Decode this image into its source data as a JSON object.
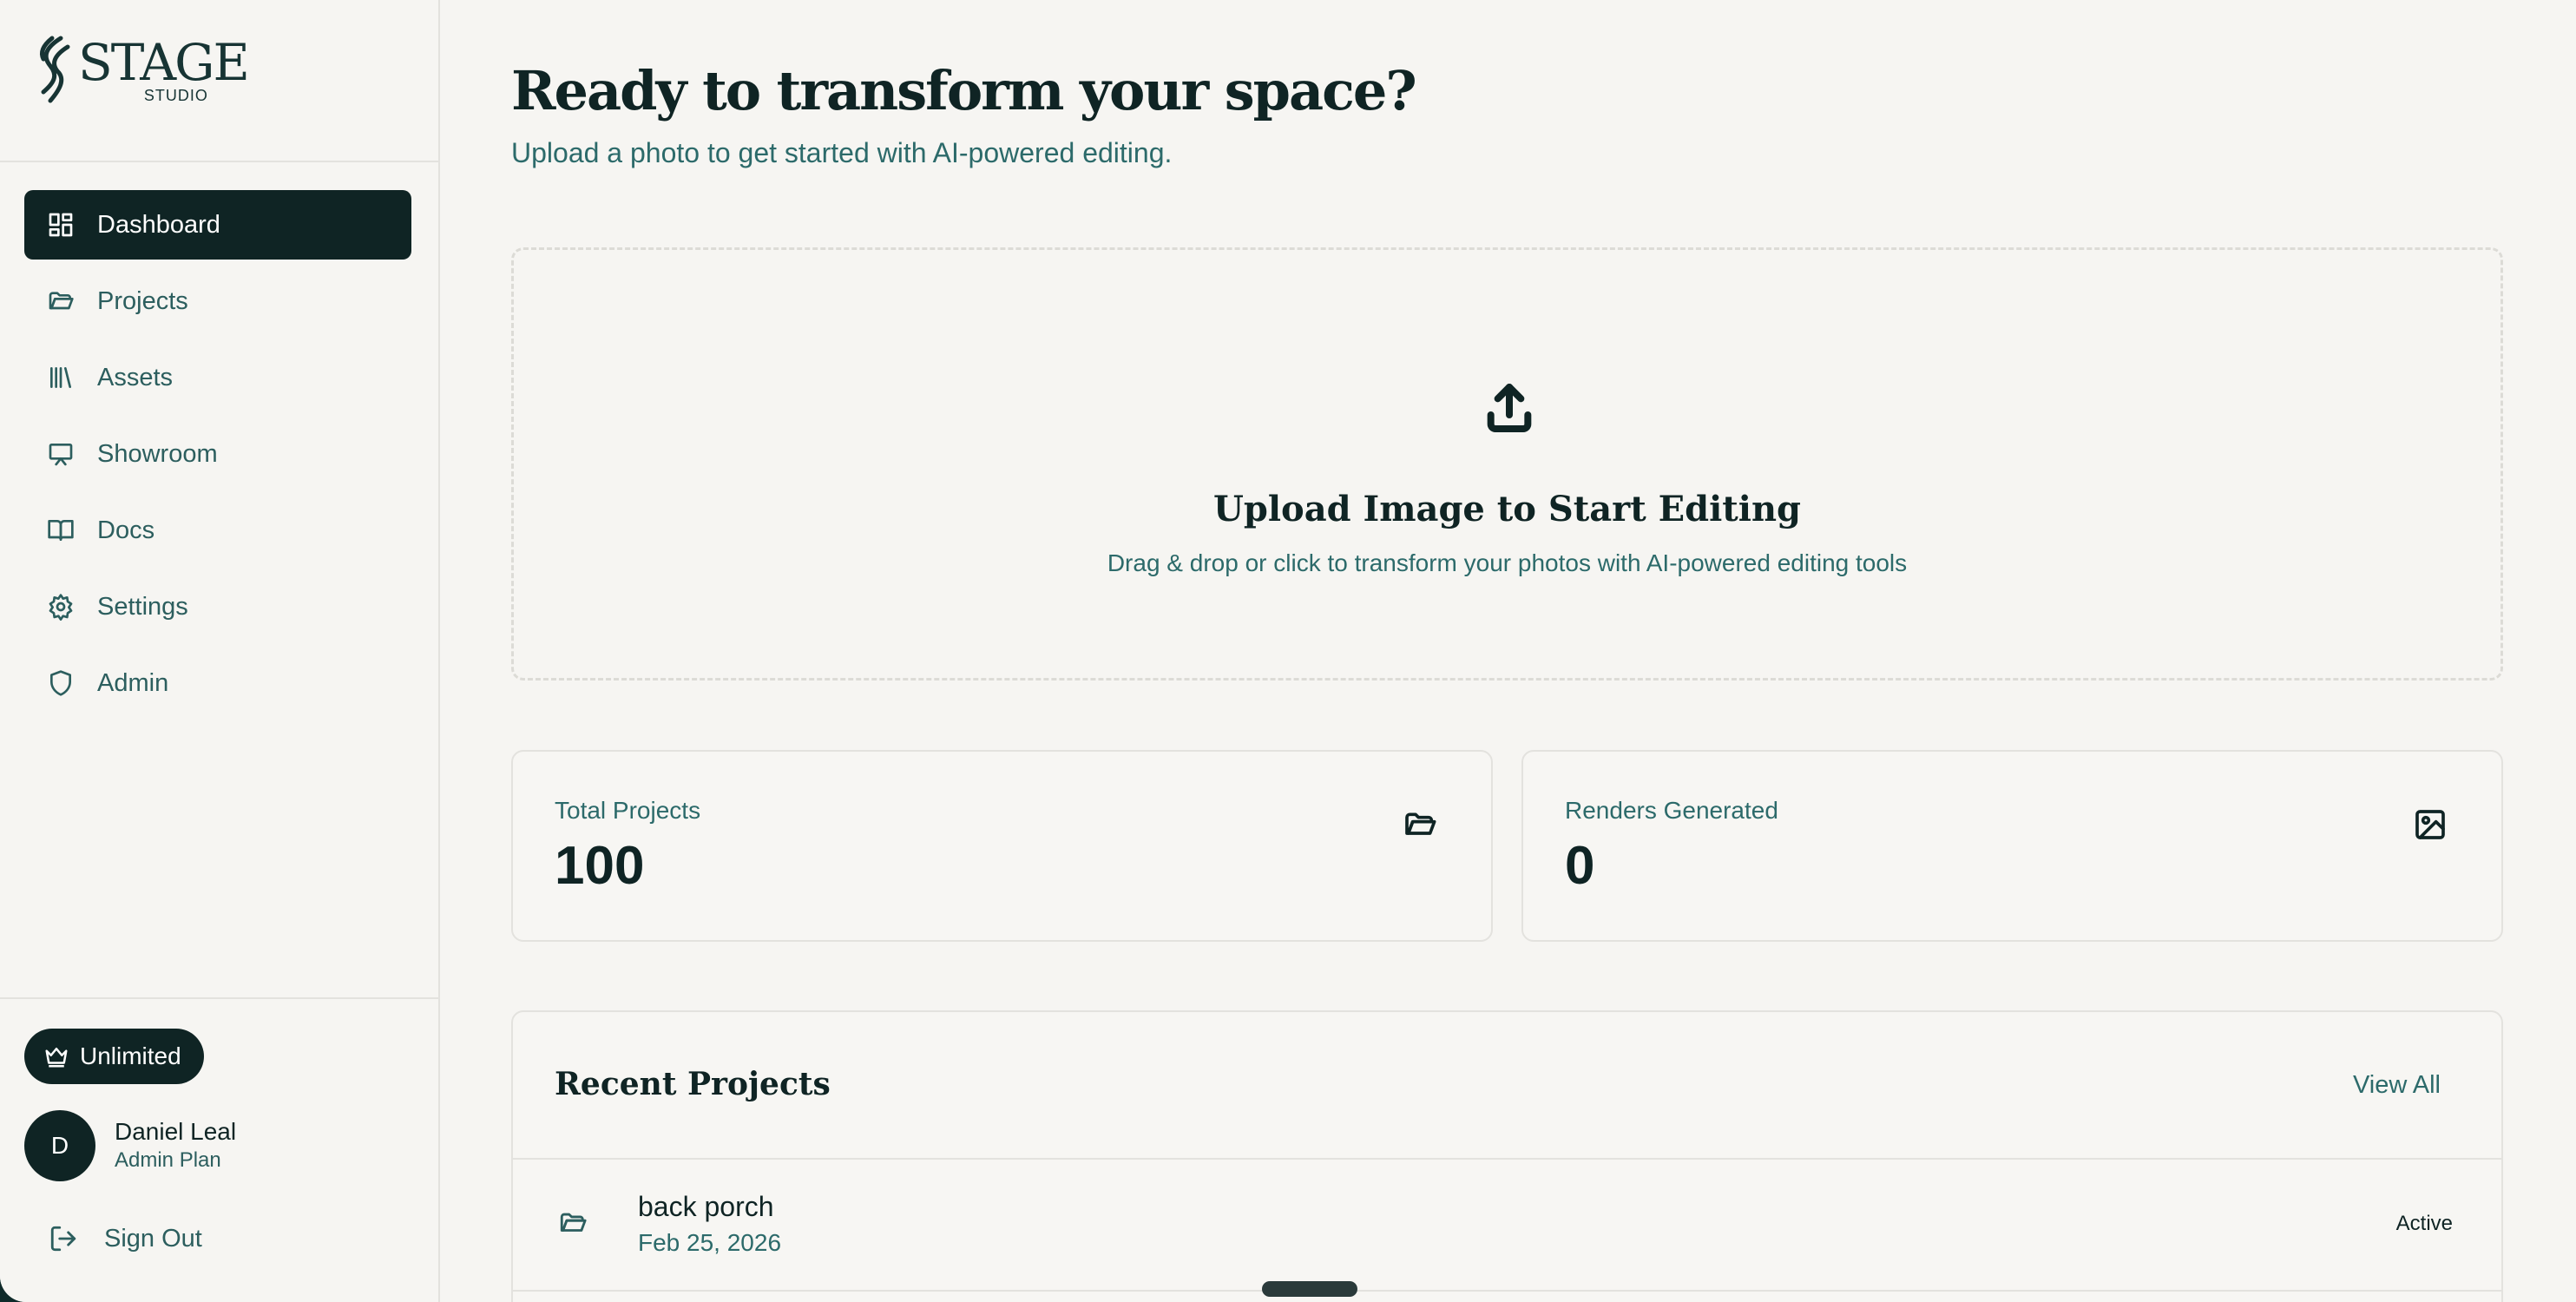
{
  "brand": {
    "name": "STAGE",
    "sub": "STUDIO"
  },
  "sidebar": {
    "items": [
      {
        "label": "Dashboard",
        "icon": "dashboard-icon",
        "active": true
      },
      {
        "label": "Projects",
        "icon": "folder-icon"
      },
      {
        "label": "Assets",
        "icon": "library-icon"
      },
      {
        "label": "Showroom",
        "icon": "presentation-icon"
      },
      {
        "label": "Docs",
        "icon": "book-icon"
      },
      {
        "label": "Settings",
        "icon": "gear-icon"
      },
      {
        "label": "Admin",
        "icon": "shield-icon"
      }
    ],
    "plan_badge": "Unlimited",
    "user": {
      "initial": "D",
      "name": "Daniel Leal",
      "plan": "Admin Plan"
    },
    "sign_out": "Sign Out"
  },
  "main": {
    "title": "Ready to transform your space?",
    "subtitle": "Upload a photo to get started with AI-powered editing.",
    "upload": {
      "title": "Upload Image to Start Editing",
      "subtitle": "Drag & drop or click to transform your photos with AI-powered editing tools"
    },
    "stats": [
      {
        "label": "Total Projects",
        "value": "100",
        "icon": "folder-icon"
      },
      {
        "label": "Renders Generated",
        "value": "0",
        "icon": "image-icon"
      }
    ],
    "recent": {
      "title": "Recent Projects",
      "view_all": "View All",
      "projects": [
        {
          "name": "back porch",
          "date": "Feb 25, 2026",
          "status": "Active"
        }
      ]
    }
  },
  "colors": {
    "accent": "#0f2424",
    "muted_text": "#2c6a6a",
    "background": "#f6f5f2"
  }
}
